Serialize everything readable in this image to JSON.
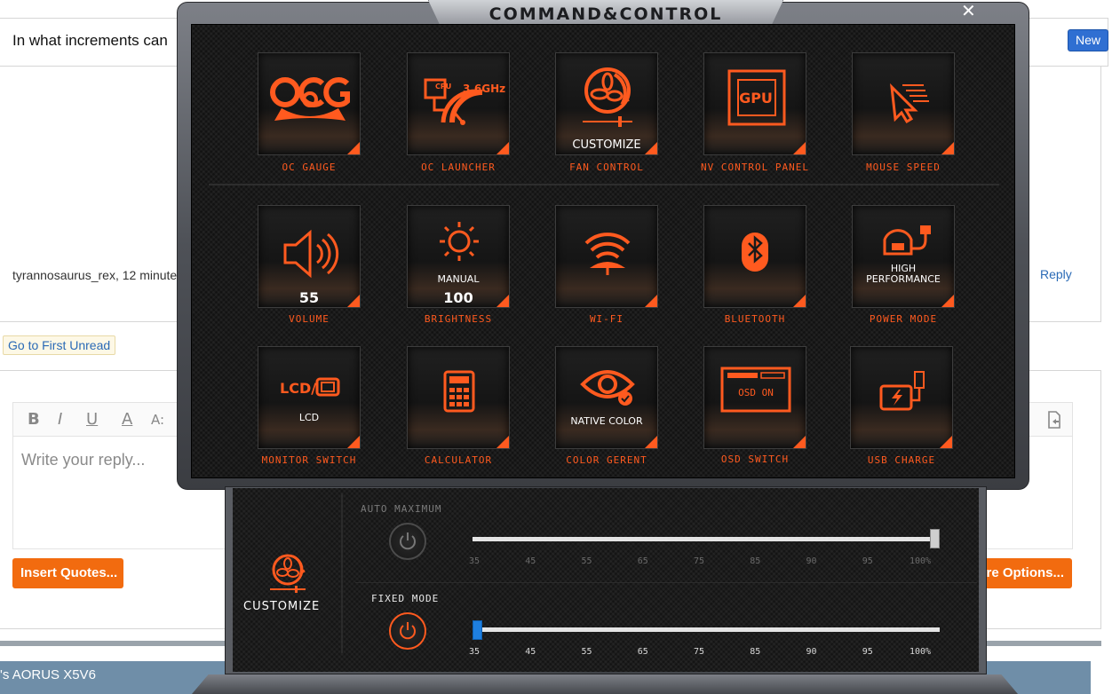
{
  "forum": {
    "post_text": "In what increments can",
    "post_author": "tyrannosaurus_rex, 12 minute",
    "reply_link": "Reply",
    "new_badge": "New",
    "go_first_unread": "Go to First Unread",
    "toolbar": {
      "bold": "B",
      "italic": "I",
      "underline": "U",
      "font_color": "A",
      "font_size": "A:"
    },
    "editor_placeholder": "Write your reply...",
    "insert_quotes": "Insert Quotes...",
    "more_options": "re Options...",
    "footer_text": "'s AORUS X5V6"
  },
  "cc": {
    "title": "COMMAND&CONTROL",
    "close": "✕",
    "accent_color": "#ff5a1f",
    "tiles": [
      {
        "label": "OC GAUGE",
        "icon": "oc-gauge-icon"
      },
      {
        "label": "OC LAUNCHER",
        "icon": "cpu-gauge-icon",
        "cpu_text": "CPU",
        "ghz_text": "3.6GHz"
      },
      {
        "label": "FAN CONTROL",
        "icon": "fan-icon",
        "value": "CUSTOMIZE"
      },
      {
        "label": "NV CONTROL PANEL",
        "icon": "gpu-icon",
        "gpu_text": "GPU"
      },
      {
        "label": "MOUSE SPEED",
        "icon": "cursor-speed-icon"
      },
      {
        "label": "VOLUME",
        "icon": "speaker-icon",
        "value": "55"
      },
      {
        "label": "BRIGHTNESS",
        "icon": "sun-icon",
        "sub": "MANUAL",
        "value": "100"
      },
      {
        "label": "WI-FI",
        "icon": "wifi-icon"
      },
      {
        "label": "BLUETOOTH",
        "icon": "bluetooth-icon"
      },
      {
        "label": "POWER MODE",
        "icon": "power-plug-icon",
        "sub": "HIGH",
        "value": "PERFORMANCE"
      },
      {
        "label": "MONITOR SWITCH",
        "icon": "lcd-switch-icon",
        "icon_text": "LCD/",
        "value": "LCD"
      },
      {
        "label": "CALCULATOR",
        "icon": "calculator-icon"
      },
      {
        "label": "COLOR GERENT",
        "icon": "eye-icon",
        "value": "NATIVE COLOR"
      },
      {
        "label": "OSD SWITCH",
        "icon": "osd-icon",
        "icon_text": "OSD ON"
      },
      {
        "label": "USB CHARGE",
        "icon": "usb-charge-icon"
      }
    ]
  },
  "fan": {
    "customize_label": "CUSTOMIZE",
    "auto_label": "AUTO MAXIMUM",
    "fixed_label": "FIXED MODE",
    "ticks": [
      "35",
      "45",
      "55",
      "65",
      "75",
      "85",
      "90",
      "95",
      "100%"
    ],
    "auto_value_percent": 100,
    "fixed_value_percent": 35
  }
}
